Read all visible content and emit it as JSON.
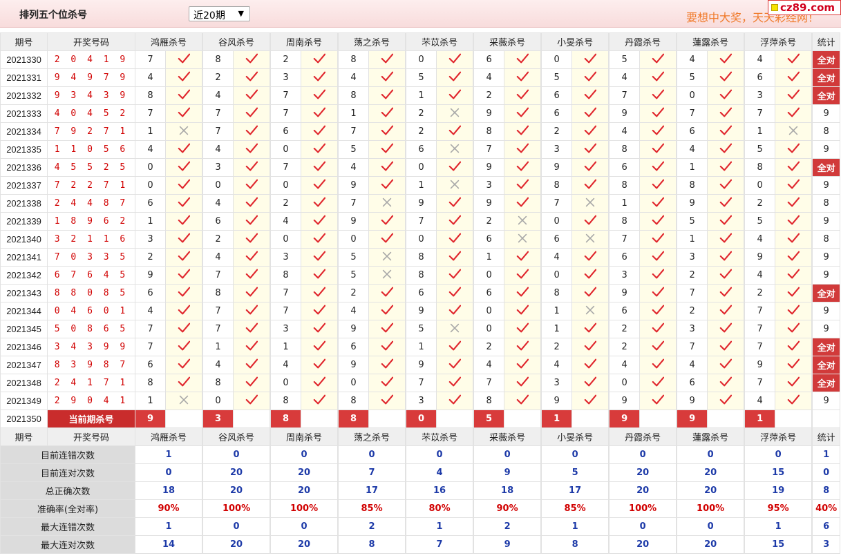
{
  "header": {
    "title": "排列五个位杀号",
    "period_select": "近20期",
    "period_arrow": "▼",
    "slogan": "要想中大奖，天天彩经网！",
    "site_badge": "cz89.com"
  },
  "columns": {
    "period": "期号",
    "draw": "开奖号码",
    "experts": [
      "鸿雁杀号",
      "谷风杀号",
      "周南杀号",
      "荡之杀号",
      "芣苡杀号",
      "采薇杀号",
      "小旻杀号",
      "丹霞杀号",
      "蓮露杀号",
      "浮萍杀号"
    ],
    "stats": "统计"
  },
  "rows": [
    {
      "period": "2021330",
      "draw": "2 0 4 1 9",
      "kills": [
        "7",
        "8",
        "2",
        "8",
        "0",
        "6",
        "0",
        "5",
        "4",
        "4"
      ],
      "hits": [
        1,
        1,
        1,
        1,
        1,
        1,
        1,
        1,
        1,
        1
      ],
      "stat": "全对"
    },
    {
      "period": "2021331",
      "draw": "9 4 9 7 9",
      "kills": [
        "4",
        "2",
        "3",
        "4",
        "5",
        "4",
        "5",
        "4",
        "5",
        "6"
      ],
      "hits": [
        1,
        1,
        1,
        1,
        1,
        1,
        1,
        1,
        1,
        1
      ],
      "stat": "全对"
    },
    {
      "period": "2021332",
      "draw": "9 3 4 3 9",
      "kills": [
        "8",
        "4",
        "7",
        "8",
        "1",
        "2",
        "6",
        "7",
        "0",
        "3"
      ],
      "hits": [
        1,
        1,
        1,
        1,
        1,
        1,
        1,
        1,
        1,
        1
      ],
      "stat": "全对"
    },
    {
      "period": "2021333",
      "draw": "4 0 4 5 2",
      "kills": [
        "7",
        "7",
        "7",
        "1",
        "2",
        "9",
        "6",
        "9",
        "7",
        "7"
      ],
      "hits": [
        1,
        1,
        1,
        1,
        0,
        1,
        1,
        1,
        1,
        1
      ],
      "stat": "9"
    },
    {
      "period": "2021334",
      "draw": "7 9 2 7 1",
      "kills": [
        "1",
        "7",
        "6",
        "7",
        "2",
        "8",
        "2",
        "4",
        "6",
        "1"
      ],
      "hits": [
        0,
        1,
        1,
        1,
        1,
        1,
        1,
        1,
        1,
        0
      ],
      "stat": "8"
    },
    {
      "period": "2021335",
      "draw": "1 1 0 5 6",
      "kills": [
        "4",
        "4",
        "0",
        "5",
        "6",
        "7",
        "3",
        "8",
        "4",
        "5"
      ],
      "hits": [
        1,
        1,
        1,
        1,
        0,
        1,
        1,
        1,
        1,
        1
      ],
      "stat": "9"
    },
    {
      "period": "2021336",
      "draw": "4 5 5 2 5",
      "kills": [
        "0",
        "3",
        "7",
        "4",
        "0",
        "9",
        "9",
        "6",
        "1",
        "8"
      ],
      "hits": [
        1,
        1,
        1,
        1,
        1,
        1,
        1,
        1,
        1,
        1
      ],
      "stat": "全对"
    },
    {
      "period": "2021337",
      "draw": "7 2 2 7 1",
      "kills": [
        "0",
        "0",
        "0",
        "9",
        "1",
        "3",
        "8",
        "8",
        "8",
        "0"
      ],
      "hits": [
        1,
        1,
        1,
        1,
        0,
        1,
        1,
        1,
        1,
        1
      ],
      "stat": "9"
    },
    {
      "period": "2021338",
      "draw": "2 4 4 8 7",
      "kills": [
        "6",
        "4",
        "2",
        "7",
        "9",
        "9",
        "7",
        "1",
        "9",
        "2"
      ],
      "hits": [
        1,
        1,
        1,
        0,
        1,
        1,
        0,
        1,
        1,
        1
      ],
      "stat": "8"
    },
    {
      "period": "2021339",
      "draw": "1 8 9 6 2",
      "kills": [
        "1",
        "6",
        "4",
        "9",
        "7",
        "2",
        "0",
        "8",
        "5",
        "5"
      ],
      "hits": [
        1,
        1,
        1,
        1,
        1,
        0,
        1,
        1,
        1,
        1
      ],
      "stat": "9"
    },
    {
      "period": "2021340",
      "draw": "3 2 1 1 6",
      "kills": [
        "3",
        "2",
        "0",
        "0",
        "0",
        "6",
        "6",
        "7",
        "1",
        "4"
      ],
      "hits": [
        1,
        1,
        1,
        1,
        1,
        0,
        0,
        1,
        1,
        1
      ],
      "stat": "8"
    },
    {
      "period": "2021341",
      "draw": "7 0 3 3 5",
      "kills": [
        "2",
        "4",
        "3",
        "5",
        "8",
        "1",
        "4",
        "6",
        "3",
        "9"
      ],
      "hits": [
        1,
        1,
        1,
        0,
        1,
        1,
        1,
        1,
        1,
        1
      ],
      "stat": "9"
    },
    {
      "period": "2021342",
      "draw": "6 7 6 4 5",
      "kills": [
        "9",
        "7",
        "8",
        "5",
        "8",
        "0",
        "0",
        "3",
        "2",
        "4"
      ],
      "hits": [
        1,
        1,
        1,
        0,
        1,
        1,
        1,
        1,
        1,
        1
      ],
      "stat": "9"
    },
    {
      "period": "2021343",
      "draw": "8 8 0 8 5",
      "kills": [
        "6",
        "8",
        "7",
        "2",
        "6",
        "6",
        "8",
        "9",
        "7",
        "2"
      ],
      "hits": [
        1,
        1,
        1,
        1,
        1,
        1,
        1,
        1,
        1,
        1
      ],
      "stat": "全对"
    },
    {
      "period": "2021344",
      "draw": "0 4 6 0 1",
      "kills": [
        "4",
        "7",
        "7",
        "4",
        "9",
        "0",
        "1",
        "6",
        "2",
        "7"
      ],
      "hits": [
        1,
        1,
        1,
        1,
        1,
        1,
        0,
        1,
        1,
        1
      ],
      "stat": "9"
    },
    {
      "period": "2021345",
      "draw": "5 0 8 6 5",
      "kills": [
        "7",
        "7",
        "3",
        "9",
        "5",
        "0",
        "1",
        "2",
        "3",
        "7"
      ],
      "hits": [
        1,
        1,
        1,
        1,
        0,
        1,
        1,
        1,
        1,
        1
      ],
      "stat": "9"
    },
    {
      "period": "2021346",
      "draw": "3 4 3 9 9",
      "kills": [
        "7",
        "1",
        "1",
        "6",
        "1",
        "2",
        "2",
        "2",
        "7",
        "7"
      ],
      "hits": [
        1,
        1,
        1,
        1,
        1,
        1,
        1,
        1,
        1,
        1
      ],
      "stat": "全对"
    },
    {
      "period": "2021347",
      "draw": "8 3 9 8 7",
      "kills": [
        "6",
        "4",
        "4",
        "9",
        "9",
        "4",
        "4",
        "4",
        "4",
        "9"
      ],
      "hits": [
        1,
        1,
        1,
        1,
        1,
        1,
        1,
        1,
        1,
        1
      ],
      "stat": "全对"
    },
    {
      "period": "2021348",
      "draw": "2 4 1 7 1",
      "kills": [
        "8",
        "8",
        "0",
        "0",
        "7",
        "7",
        "3",
        "0",
        "6",
        "7"
      ],
      "hits": [
        1,
        1,
        1,
        1,
        1,
        1,
        1,
        1,
        1,
        1
      ],
      "stat": "全对"
    },
    {
      "period": "2021349",
      "draw": "2 9 0 4 1",
      "kills": [
        "1",
        "0",
        "8",
        "8",
        "3",
        "8",
        "9",
        "9",
        "9",
        "4"
      ],
      "hits": [
        0,
        1,
        1,
        1,
        1,
        1,
        1,
        1,
        1,
        1
      ],
      "stat": "9"
    }
  ],
  "current": {
    "period": "2021350",
    "label": "当前期杀号",
    "kills": [
      "9",
      "3",
      "8",
      "8",
      "0",
      "5",
      "1",
      "9",
      "9",
      "1"
    ]
  },
  "summary": [
    {
      "label": "目前连错次数",
      "values": [
        "1",
        "0",
        "0",
        "0",
        "0",
        "0",
        "0",
        "0",
        "0",
        "0"
      ],
      "stat": "1",
      "red": false
    },
    {
      "label": "目前连对次数",
      "values": [
        "0",
        "20",
        "20",
        "7",
        "4",
        "9",
        "5",
        "20",
        "20",
        "15"
      ],
      "stat": "0",
      "red": false
    },
    {
      "label": "总正确次数",
      "values": [
        "18",
        "20",
        "20",
        "17",
        "16",
        "18",
        "17",
        "20",
        "20",
        "19"
      ],
      "stat": "8",
      "red": false
    },
    {
      "label": "准确率(全对率)",
      "values": [
        "90%",
        "100%",
        "100%",
        "85%",
        "80%",
        "90%",
        "85%",
        "100%",
        "100%",
        "95%"
      ],
      "stat": "40%",
      "red": true
    },
    {
      "label": "最大连错次数",
      "values": [
        "1",
        "0",
        "0",
        "2",
        "1",
        "2",
        "1",
        "0",
        "0",
        "1"
      ],
      "stat": "6",
      "red": false
    },
    {
      "label": "最大连对次数",
      "values": [
        "14",
        "20",
        "20",
        "8",
        "7",
        "9",
        "8",
        "20",
        "20",
        "15"
      ],
      "stat": "3",
      "red": false
    }
  ],
  "colors": {
    "check": "#e0262d",
    "cross": "#a8a8a8",
    "accent": "#d13a3a",
    "summary_blue": "#1d3aa8"
  }
}
